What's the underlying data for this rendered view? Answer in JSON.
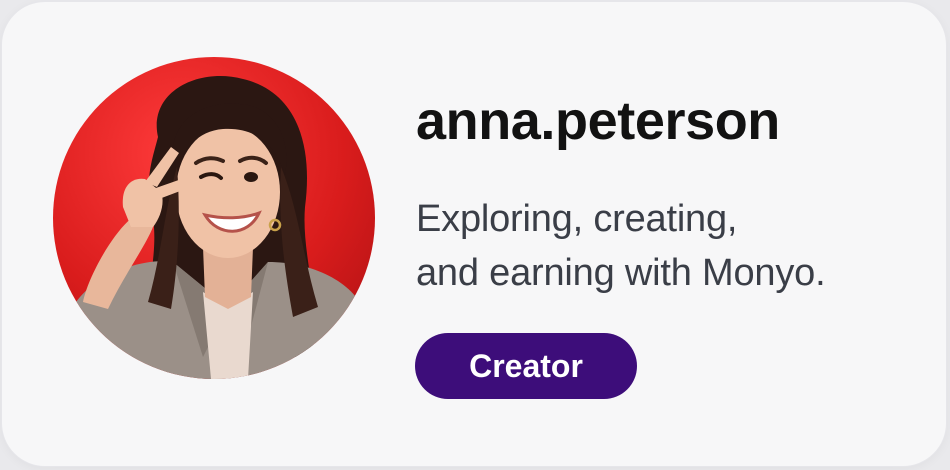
{
  "profile": {
    "username": "anna.peterson",
    "bio_lines": [
      "Exploring, creating,",
      "and earning with Monyo."
    ],
    "badge_label": "Creator",
    "badge_color": "#3d0d7a",
    "avatar_background_color": "#e02222"
  }
}
